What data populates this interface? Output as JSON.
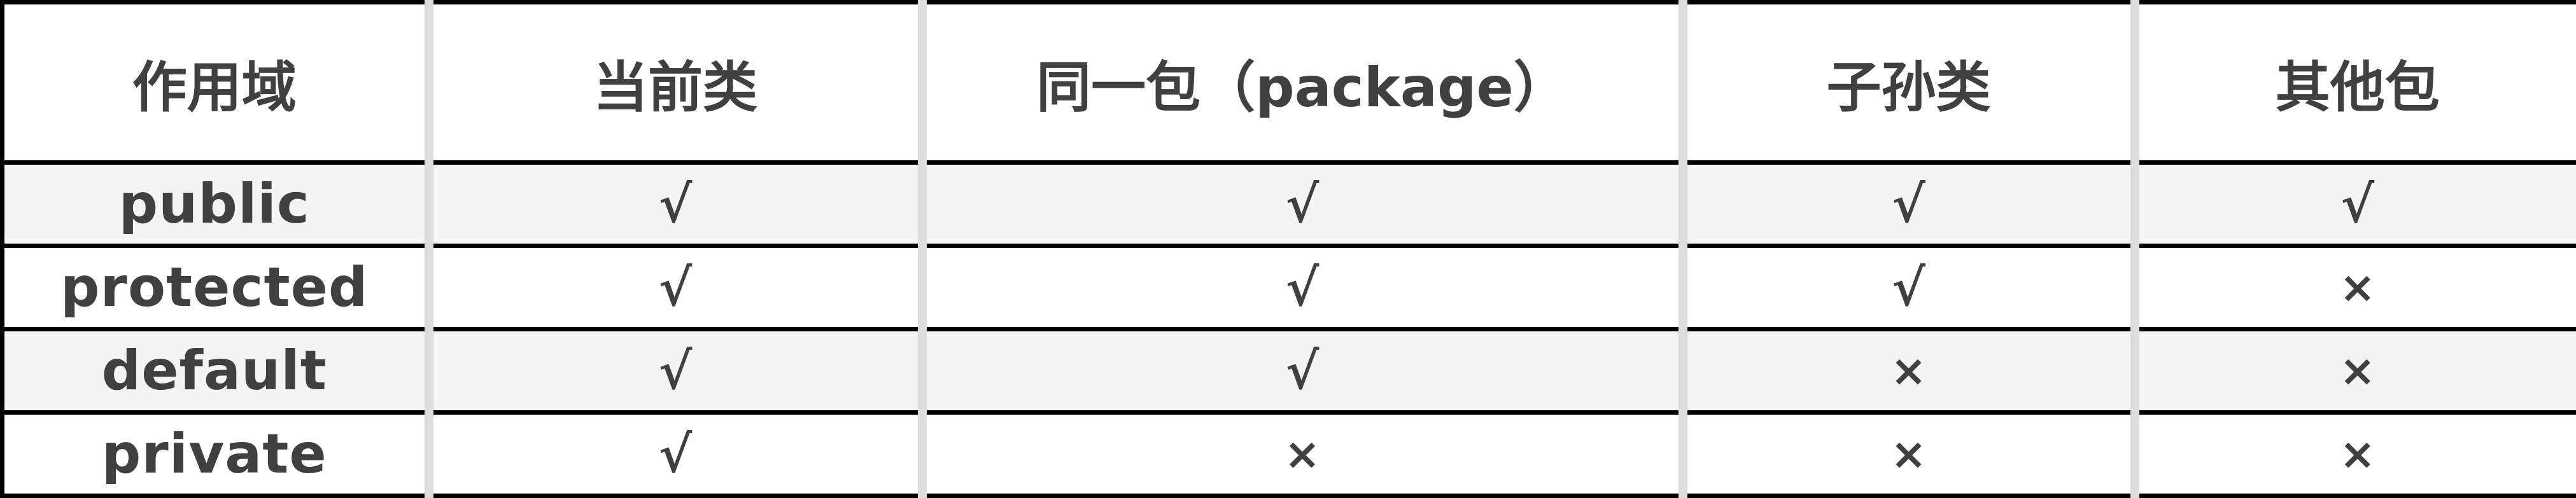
{
  "table": {
    "headers": [
      "作用域",
      "当前类",
      "同一包（package）",
      "子孙类",
      "其他包"
    ],
    "rows": [
      {
        "scope": "public",
        "cells": [
          "√",
          "√",
          "√",
          "√"
        ]
      },
      {
        "scope": "protected",
        "cells": [
          "√",
          "√",
          "√",
          "×"
        ]
      },
      {
        "scope": "default",
        "cells": [
          "√",
          "√",
          "×",
          "×"
        ]
      },
      {
        "scope": "private",
        "cells": [
          "√",
          "×",
          "×",
          "×"
        ]
      }
    ]
  },
  "colors": {
    "text": "#404040",
    "border_dark": "#000000",
    "column_divider": "#dcdcdc",
    "row_shade": "#f4f4f4"
  }
}
